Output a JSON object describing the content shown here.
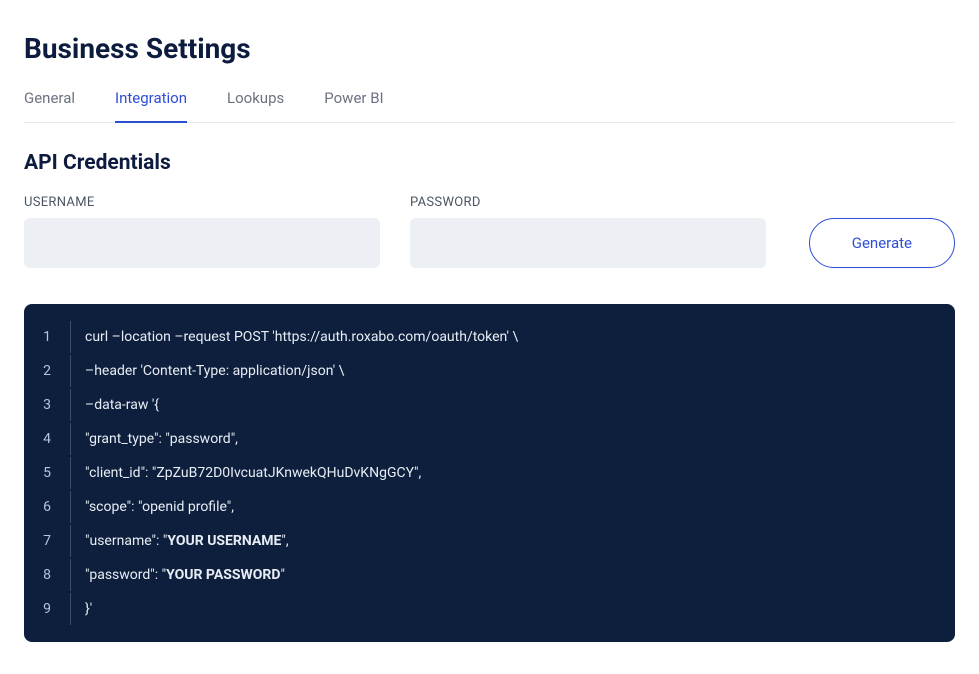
{
  "page_title": "Business Settings",
  "tabs": [
    {
      "label": "General",
      "active": false
    },
    {
      "label": "Integration",
      "active": true
    },
    {
      "label": "Lookups",
      "active": false
    },
    {
      "label": "Power BI",
      "active": false
    }
  ],
  "section_title": "API Credentials",
  "fields": {
    "username": {
      "label": "USERNAME",
      "value": ""
    },
    "password": {
      "label": "PASSWORD",
      "value": ""
    }
  },
  "buttons": {
    "generate": "Generate"
  },
  "code": {
    "lines": [
      {
        "num": "1",
        "segments": [
          {
            "text": "curl –location –request POST 'https://auth.roxabo.com/oauth/token' \\",
            "bold": false
          }
        ]
      },
      {
        "num": "2",
        "segments": [
          {
            "text": "–header 'Content-Type: application/json' \\",
            "bold": false
          }
        ]
      },
      {
        "num": "3",
        "segments": [
          {
            "text": "–data-raw '{",
            "bold": false
          }
        ]
      },
      {
        "num": "4",
        "segments": [
          {
            "text": "\"grant_type\": \"password\",",
            "bold": false
          }
        ]
      },
      {
        "num": "5",
        "segments": [
          {
            "text": "\"client_id\": \"ZpZuB72D0IvcuatJKnwekQHuDvKNgGCY\",",
            "bold": false
          }
        ]
      },
      {
        "num": "6",
        "segments": [
          {
            "text": "\"scope\": \"openid profile\",",
            "bold": false
          }
        ]
      },
      {
        "num": "7",
        "segments": [
          {
            "text": "\"username\": \"",
            "bold": false
          },
          {
            "text": "YOUR USERNAME",
            "bold": true
          },
          {
            "text": "\",",
            "bold": false
          }
        ]
      },
      {
        "num": "8",
        "segments": [
          {
            "text": "\"password\": \"",
            "bold": false
          },
          {
            "text": "YOUR PASSWORD",
            "bold": true
          },
          {
            "text": "\"",
            "bold": false
          }
        ]
      },
      {
        "num": "9",
        "segments": [
          {
            "text": "}'",
            "bold": false
          }
        ]
      }
    ]
  }
}
